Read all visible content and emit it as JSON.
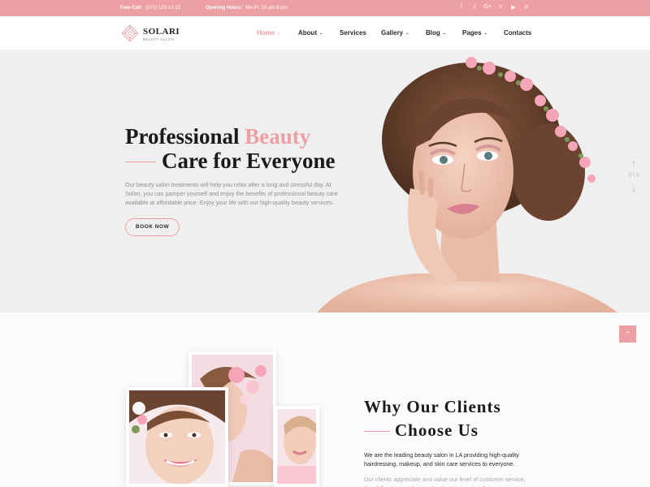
{
  "topbar": {
    "call_label": "Free Call:",
    "call_value": "(073) 123-12-12",
    "hours_label": "Opening Hours:",
    "hours_value": "Mn-Fr: 10 am-8 pm",
    "socials": [
      "f",
      "t",
      "G+",
      "v",
      "in",
      "p"
    ],
    "bg_color": "#eda0a3"
  },
  "logo": {
    "name": "SOLARI",
    "tagline": "BEAUTY SALON"
  },
  "nav": {
    "items": [
      {
        "label": "Home",
        "dropdown": true,
        "active": true
      },
      {
        "label": "About",
        "dropdown": true,
        "active": false
      },
      {
        "label": "Services",
        "dropdown": false,
        "active": false
      },
      {
        "label": "Gallery",
        "dropdown": true,
        "active": false
      },
      {
        "label": "Blog",
        "dropdown": true,
        "active": false
      },
      {
        "label": "Pages",
        "dropdown": true,
        "active": false
      },
      {
        "label": "Contacts",
        "dropdown": false,
        "active": false
      }
    ]
  },
  "hero": {
    "title_part1": "Professional",
    "title_accent": "Beauty",
    "title_line2": "Care for Everyone",
    "text": "Our beauty salon treatments will help you relax after a long and stressful day. At Solari, you can pamper yourself and enjoy the benefits of professional beauty care available at affordable price. Enjoy your life with our high-quality beauty services.",
    "button": "BOOK NOW",
    "slide_counter": "3 \\ 3",
    "accent_color": "#eda0a3"
  },
  "why": {
    "title_line1": "Why Our Clients",
    "title_line2": "Choose Us",
    "text": "We are the leading beauty salon in LA providing high-quality hairdressing, makeup, and skin care services to everyone.",
    "text2": "Our clients appreciate and value our level of customer service, the skills of our stylists and estheticians as well as"
  }
}
